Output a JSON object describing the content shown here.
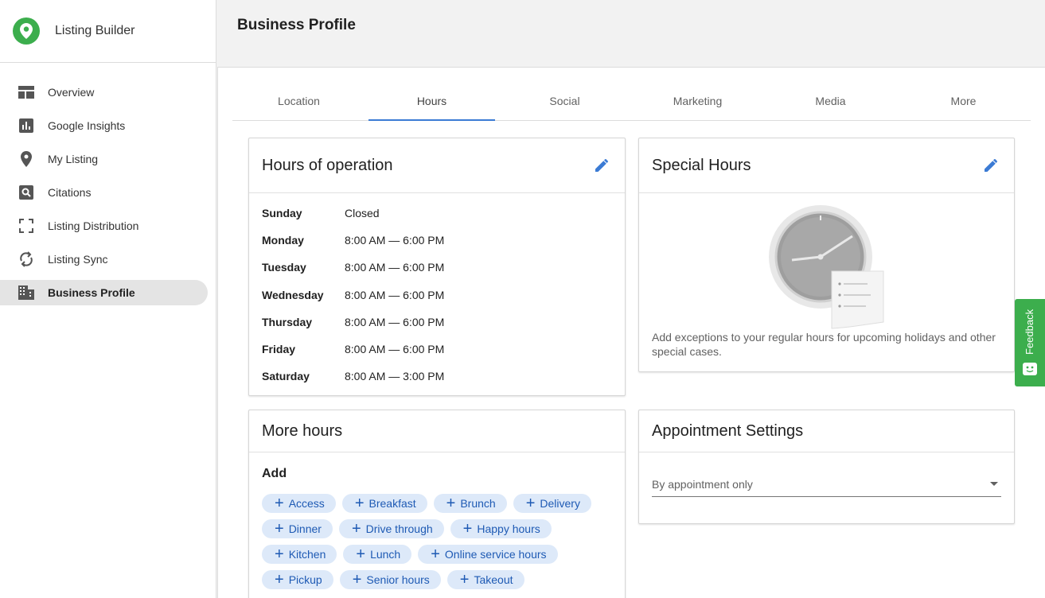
{
  "app": {
    "title": "Listing Builder",
    "logo_icon": "map-pin-icon",
    "brand_color": "#3cae4d"
  },
  "sidebar": {
    "items": [
      {
        "label": "Overview",
        "icon": "dashboard-icon",
        "active": false
      },
      {
        "label": "Google Insights",
        "icon": "bar-chart-icon",
        "active": false
      },
      {
        "label": "My Listing",
        "icon": "location-pin-icon",
        "active": false
      },
      {
        "label": "Citations",
        "icon": "search-box-icon",
        "active": false
      },
      {
        "label": "Listing Distribution",
        "icon": "expand-icon",
        "active": false
      },
      {
        "label": "Listing Sync",
        "icon": "sync-icon",
        "active": false
      },
      {
        "label": "Business Profile",
        "icon": "building-icon",
        "active": true
      }
    ]
  },
  "header": {
    "title": "Business Profile"
  },
  "tabs": [
    {
      "label": "Location",
      "active": false
    },
    {
      "label": "Hours",
      "active": true
    },
    {
      "label": "Social",
      "active": false
    },
    {
      "label": "Marketing",
      "active": false
    },
    {
      "label": "Media",
      "active": false
    },
    {
      "label": "More",
      "active": false
    }
  ],
  "hours_card": {
    "title": "Hours of operation",
    "rows": [
      {
        "day": "Sunday",
        "hours": "Closed"
      },
      {
        "day": "Monday",
        "hours": "8:00 AM — 6:00 PM"
      },
      {
        "day": "Tuesday",
        "hours": "8:00 AM — 6:00 PM"
      },
      {
        "day": "Wednesday",
        "hours": "8:00 AM — 6:00 PM"
      },
      {
        "day": "Thursday",
        "hours": "8:00 AM — 6:00 PM"
      },
      {
        "day": "Friday",
        "hours": "8:00 AM — 6:00 PM"
      },
      {
        "day": "Saturday",
        "hours": "8:00 AM — 3:00 PM"
      }
    ]
  },
  "special_card": {
    "title": "Special Hours",
    "description": "Add exceptions to your regular hours for upcoming holidays and other special cases."
  },
  "more_hours_card": {
    "title": "More hours",
    "add_label": "Add",
    "chips": [
      "Access",
      "Breakfast",
      "Brunch",
      "Delivery",
      "Dinner",
      "Drive through",
      "Happy hours",
      "Kitchen",
      "Lunch",
      "Online service hours",
      "Pickup",
      "Senior hours",
      "Takeout"
    ]
  },
  "appointment_card": {
    "title": "Appointment Settings",
    "select_value": "By appointment only"
  },
  "feedback": {
    "label": "Feedback"
  },
  "colors": {
    "accent": "#3b7bd4",
    "chip_bg": "#dde9f9",
    "chip_text": "#1e5ab4",
    "feedback_bg": "#3cae4d"
  }
}
